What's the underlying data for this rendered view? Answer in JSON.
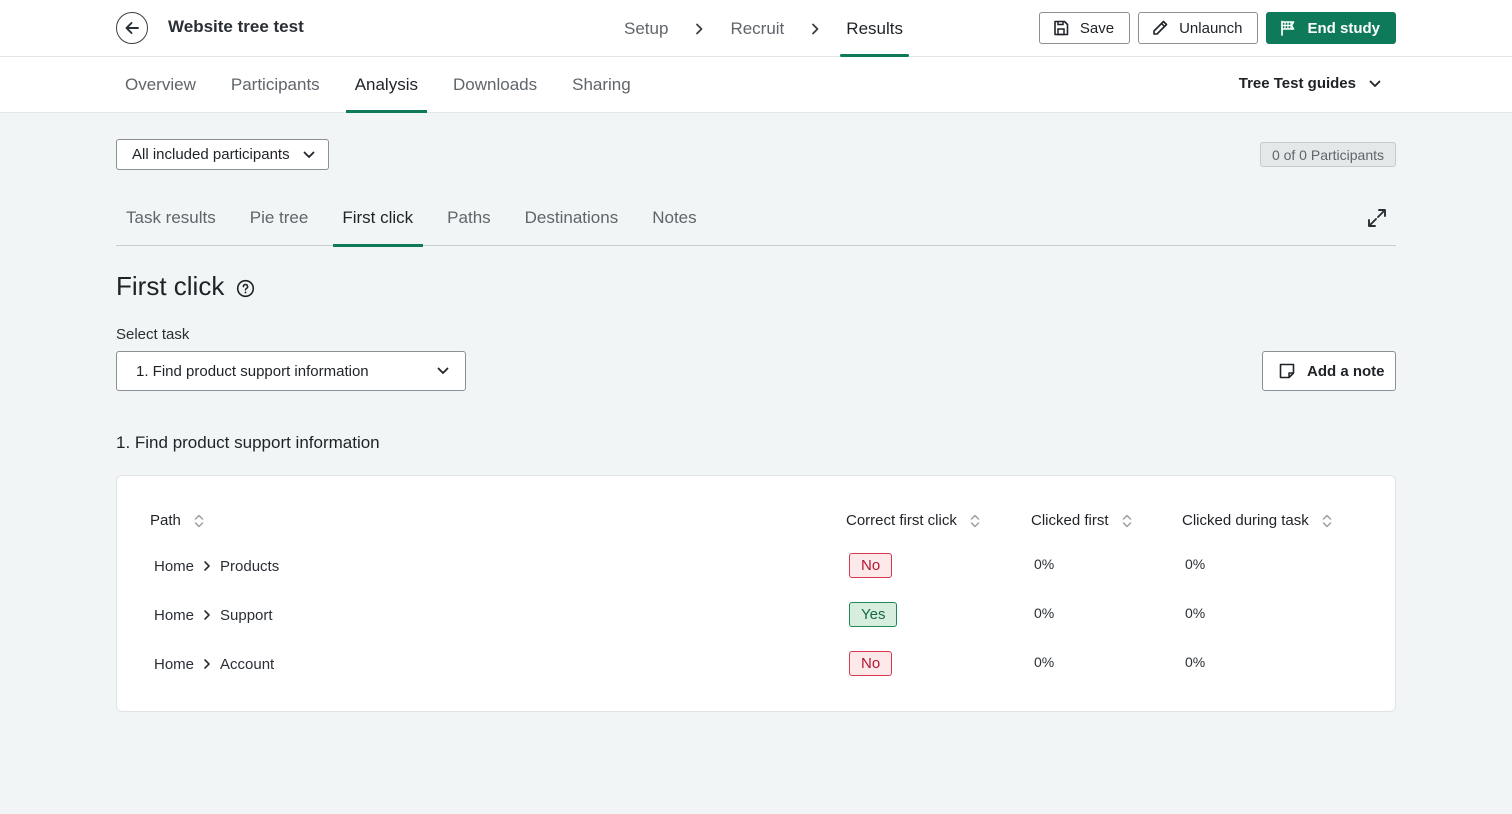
{
  "header": {
    "study_title": "Website tree test",
    "steps": [
      {
        "label": "Setup",
        "active": false
      },
      {
        "label": "Recruit",
        "active": false
      },
      {
        "label": "Results",
        "active": true
      }
    ],
    "actions": {
      "save": "Save",
      "unlaunch": "Unlaunch",
      "end_study": "End study"
    },
    "accent_color": "#0e7a5a"
  },
  "subnav": {
    "tabs": [
      "Overview",
      "Participants",
      "Analysis",
      "Downloads",
      "Sharing"
    ],
    "active_tab": "Analysis",
    "guides_label": "Tree Test guides"
  },
  "filters": {
    "participants_select": "All included participants",
    "count_badge": "0 of 0 Participants"
  },
  "analysis_tabs": {
    "tabs": [
      "Task results",
      "Pie tree",
      "First click",
      "Paths",
      "Destinations",
      "Notes"
    ],
    "active_tab": "First click"
  },
  "section": {
    "title": "First click",
    "select_label": "Select task",
    "selected_task": "1. Find product support information",
    "add_note_label": "Add a note",
    "task_heading": "1. Find product support information"
  },
  "table": {
    "columns": [
      "Path",
      "Correct first click",
      "Clicked first",
      "Clicked during task"
    ],
    "rows": [
      {
        "path": [
          "Home",
          "Products"
        ],
        "correct": "No",
        "correct_status": "no",
        "clicked_first": "0%",
        "clicked_during": "0%"
      },
      {
        "path": [
          "Home",
          "Support"
        ],
        "correct": "Yes",
        "correct_status": "yes",
        "clicked_first": "0%",
        "clicked_during": "0%"
      },
      {
        "path": [
          "Home",
          "Account"
        ],
        "correct": "No",
        "correct_status": "no",
        "clicked_first": "0%",
        "clicked_during": "0%"
      }
    ]
  }
}
